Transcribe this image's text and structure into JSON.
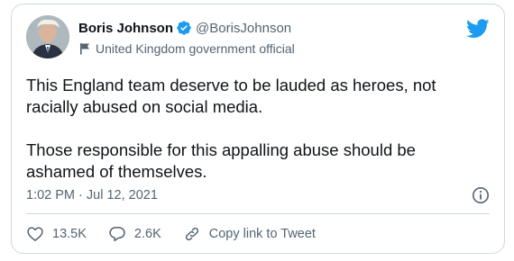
{
  "author": {
    "display_name": "Boris Johnson",
    "handle": "@BorisJohnson",
    "account_label": "United Kingdom government official",
    "verified_icon": "verified-badge-icon",
    "label_icon": "flag-icon"
  },
  "tweet": {
    "paragraphs": [
      "This England team deserve to be lauded as heroes, not racially abused on social media.",
      "Those responsible for this appalling abuse should be ashamed of themselves."
    ],
    "timestamp": "1:02 PM · Jul 12, 2021"
  },
  "actions": {
    "like_count": "13.5K",
    "reply_count": "2.6K",
    "copy_link_label": "Copy link to Tweet"
  },
  "colors": {
    "twitter_blue": "#1d9bf0",
    "text_primary": "#0f1419",
    "text_secondary": "#536471",
    "border": "#cfd9de"
  }
}
